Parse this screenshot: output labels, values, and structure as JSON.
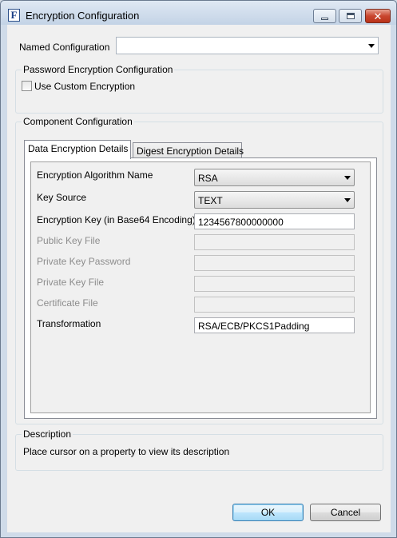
{
  "window": {
    "title": "Encryption Configuration",
    "icon": "F"
  },
  "named_configuration": {
    "label": "Named Configuration",
    "value": ""
  },
  "password_group": {
    "title": "Password Encryption Configuration",
    "use_custom_label": "Use Custom Encryption",
    "use_custom_checked": false
  },
  "component_group": {
    "title": "Component Configuration",
    "tabs": [
      {
        "label": "Data Encryption Details",
        "active": true
      },
      {
        "label": "Digest Encryption Details",
        "active": false
      }
    ],
    "fields": {
      "algorithm": {
        "label": "Encryption Algorithm Name",
        "value": "RSA"
      },
      "key_source": {
        "label": "Key Source",
        "value": "TEXT"
      },
      "encryption_key": {
        "label": "Encryption Key (in Base64 Encoding)",
        "value": "1234567800000000"
      },
      "public_key_file": {
        "label": "Public Key File",
        "value": ""
      },
      "private_key_password": {
        "label": "Private Key Password",
        "value": ""
      },
      "private_key_file": {
        "label": "Private Key File",
        "value": ""
      },
      "certificate_file": {
        "label": "Certificate File",
        "value": ""
      },
      "transformation": {
        "label": "Transformation",
        "value": "RSA/ECB/PKCS1Padding"
      }
    }
  },
  "description": {
    "title": "Description",
    "text": "Place cursor on a property to view its description"
  },
  "buttons": {
    "ok": "OK",
    "cancel": "Cancel"
  }
}
